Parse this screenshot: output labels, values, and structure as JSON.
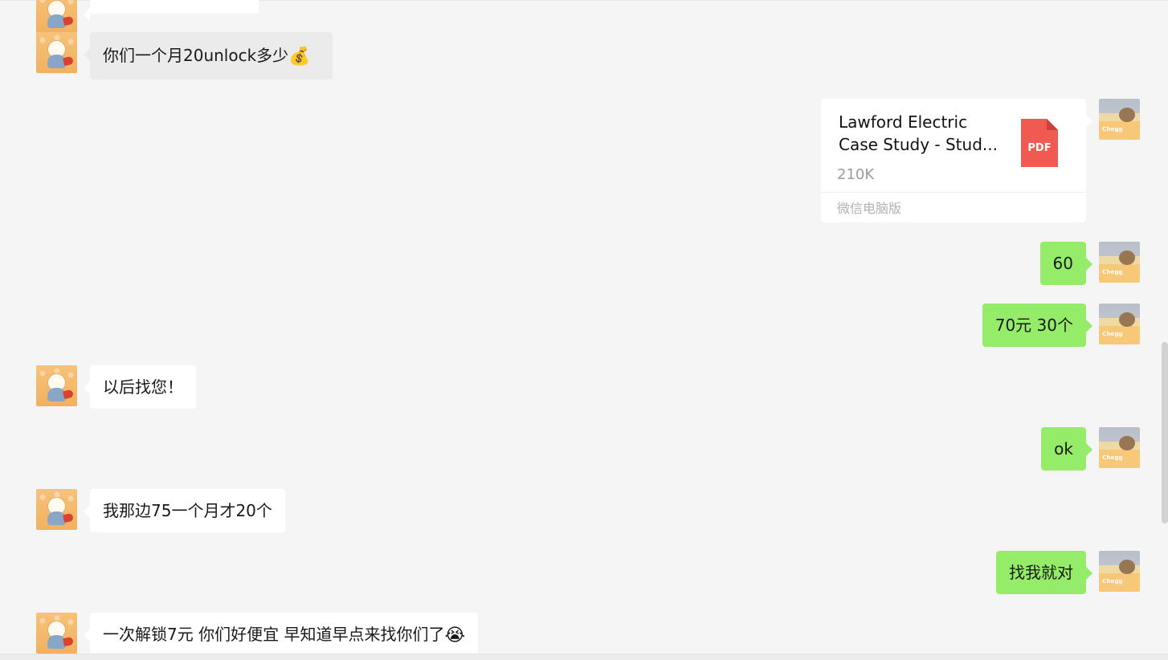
{
  "chat": {
    "colors": {
      "background": "#f5f5f5",
      "incoming_bubble": "#ffffff",
      "selected_bubble": "#ebebeb",
      "outgoing_bubble": "#95ec69"
    },
    "messages": [
      {
        "side": "left",
        "text": "你们一个月20unlock多少",
        "emoji": "💰",
        "avatar": "contact-avatar"
      },
      {
        "side": "right",
        "type": "file",
        "file": {
          "name": "Lawford Electric\nCase Study - Stud...",
          "size": "210K",
          "icon": "PDF",
          "source": "微信电脑版"
        },
        "avatar": "user-avatar"
      },
      {
        "side": "right",
        "text": "60",
        "avatar": "user-avatar"
      },
      {
        "side": "right",
        "text": "70元 30个",
        "avatar": "user-avatar"
      },
      {
        "side": "left",
        "text": "以后找您！",
        "avatar": "contact-avatar"
      },
      {
        "side": "right",
        "text": "ok",
        "avatar": "user-avatar"
      },
      {
        "side": "left",
        "text": "我那边75一个月才20个",
        "avatar": "contact-avatar"
      },
      {
        "side": "right",
        "text": "找我就对",
        "avatar": "user-avatar"
      },
      {
        "side": "left",
        "text": "一次解锁7元 你们好便宜 早知道早点来找你们了",
        "emoji": "😭",
        "avatar": "contact-avatar"
      }
    ],
    "avatar_labels": {
      "user_brand": "Chegg"
    }
  }
}
